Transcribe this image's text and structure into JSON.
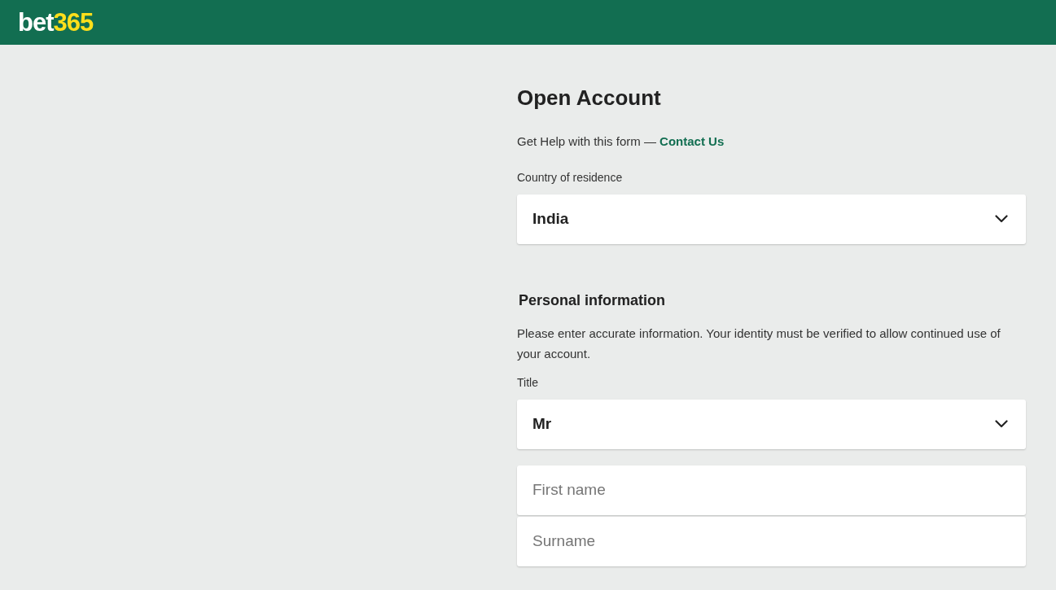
{
  "header": {
    "logo": {
      "prefix": "bet",
      "suffix": "365"
    }
  },
  "form": {
    "title": "Open Account",
    "help": {
      "text": "Get Help with this form —",
      "link": "Contact Us"
    },
    "country": {
      "label": "Country of residence",
      "value": "India"
    },
    "section": {
      "heading": "Personal information",
      "note": "Please enter accurate information. Your identity must be verified to allow continued use of your account."
    },
    "fields": [
      {
        "kind": "select",
        "label": "Title",
        "value": "Mr"
      },
      {
        "kind": "text",
        "placeholder": "First name"
      },
      {
        "kind": "text",
        "placeholder": "Surname"
      }
    ]
  }
}
